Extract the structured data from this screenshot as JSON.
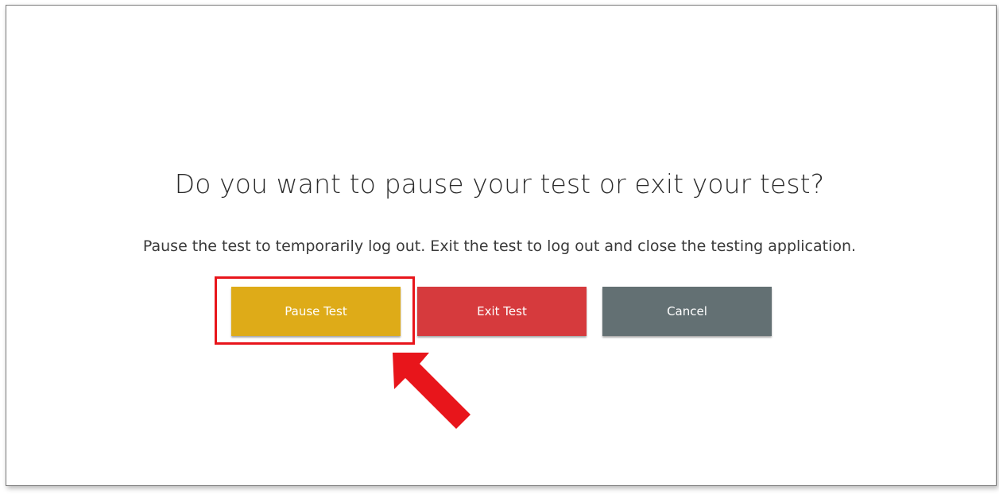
{
  "dialog": {
    "title": "Do you want to pause your test or exit your test?",
    "message": "Pause the test to temporarily log out. Exit the test to log out and close the testing application."
  },
  "buttons": {
    "pause_label": "Pause Test",
    "exit_label": "Exit Test",
    "cancel_label": "Cancel"
  },
  "colors": {
    "pause": "#deab18",
    "exit": "#d63a3d",
    "cancel": "#637073",
    "annotation": "#e8151b"
  },
  "annotation": {
    "highlight_target": "Pause Test",
    "arrow_icon": "red-arrow-pointing-up-left"
  }
}
